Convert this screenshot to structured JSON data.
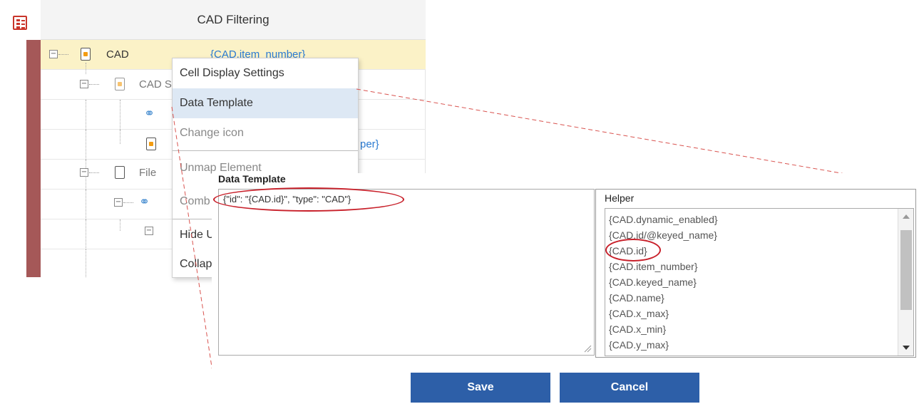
{
  "tree_panel": {
    "title": "CAD Filtering",
    "rows": [
      {
        "label": "CAD",
        "value": "{CAD.item_number}"
      },
      {
        "label": "CAD S"
      },
      {
        "label": ""
      },
      {
        "label": "",
        "value": "per}"
      },
      {
        "label": "File"
      }
    ]
  },
  "context_menu": {
    "items": [
      {
        "label": "Cell Display Settings",
        "state": "normal"
      },
      {
        "label": "Data Template",
        "state": "active"
      },
      {
        "label": "Change icon",
        "state": "disabled"
      },
      {
        "label": "Unmap Element",
        "state": "disabled"
      },
      {
        "label": "Comb",
        "state": "disabled"
      },
      {
        "label": "Hide U",
        "state": "normal"
      },
      {
        "label": "Collap",
        "state": "normal"
      }
    ]
  },
  "dialog": {
    "title": "Data Template",
    "template_value": "{\"id\": \"{CAD.id}\", \"type\": \"CAD\"}",
    "helper_title": "Helper",
    "helper_items": [
      "{CAD.dynamic_enabled}",
      "{CAD.id/@keyed_name}",
      "{CAD.id}",
      "{CAD.item_number}",
      "{CAD.keyed_name}",
      "{CAD.name}",
      "{CAD.x_max}",
      "{CAD.x_min}",
      "{CAD.y_max}"
    ],
    "save_label": "Save",
    "cancel_label": "Cancel"
  },
  "colors": {
    "accent_button": "#2d5fa8",
    "selected_row": "#fbf2c7",
    "highlight_circle": "#c8202a",
    "sidebar": "#a55858"
  }
}
